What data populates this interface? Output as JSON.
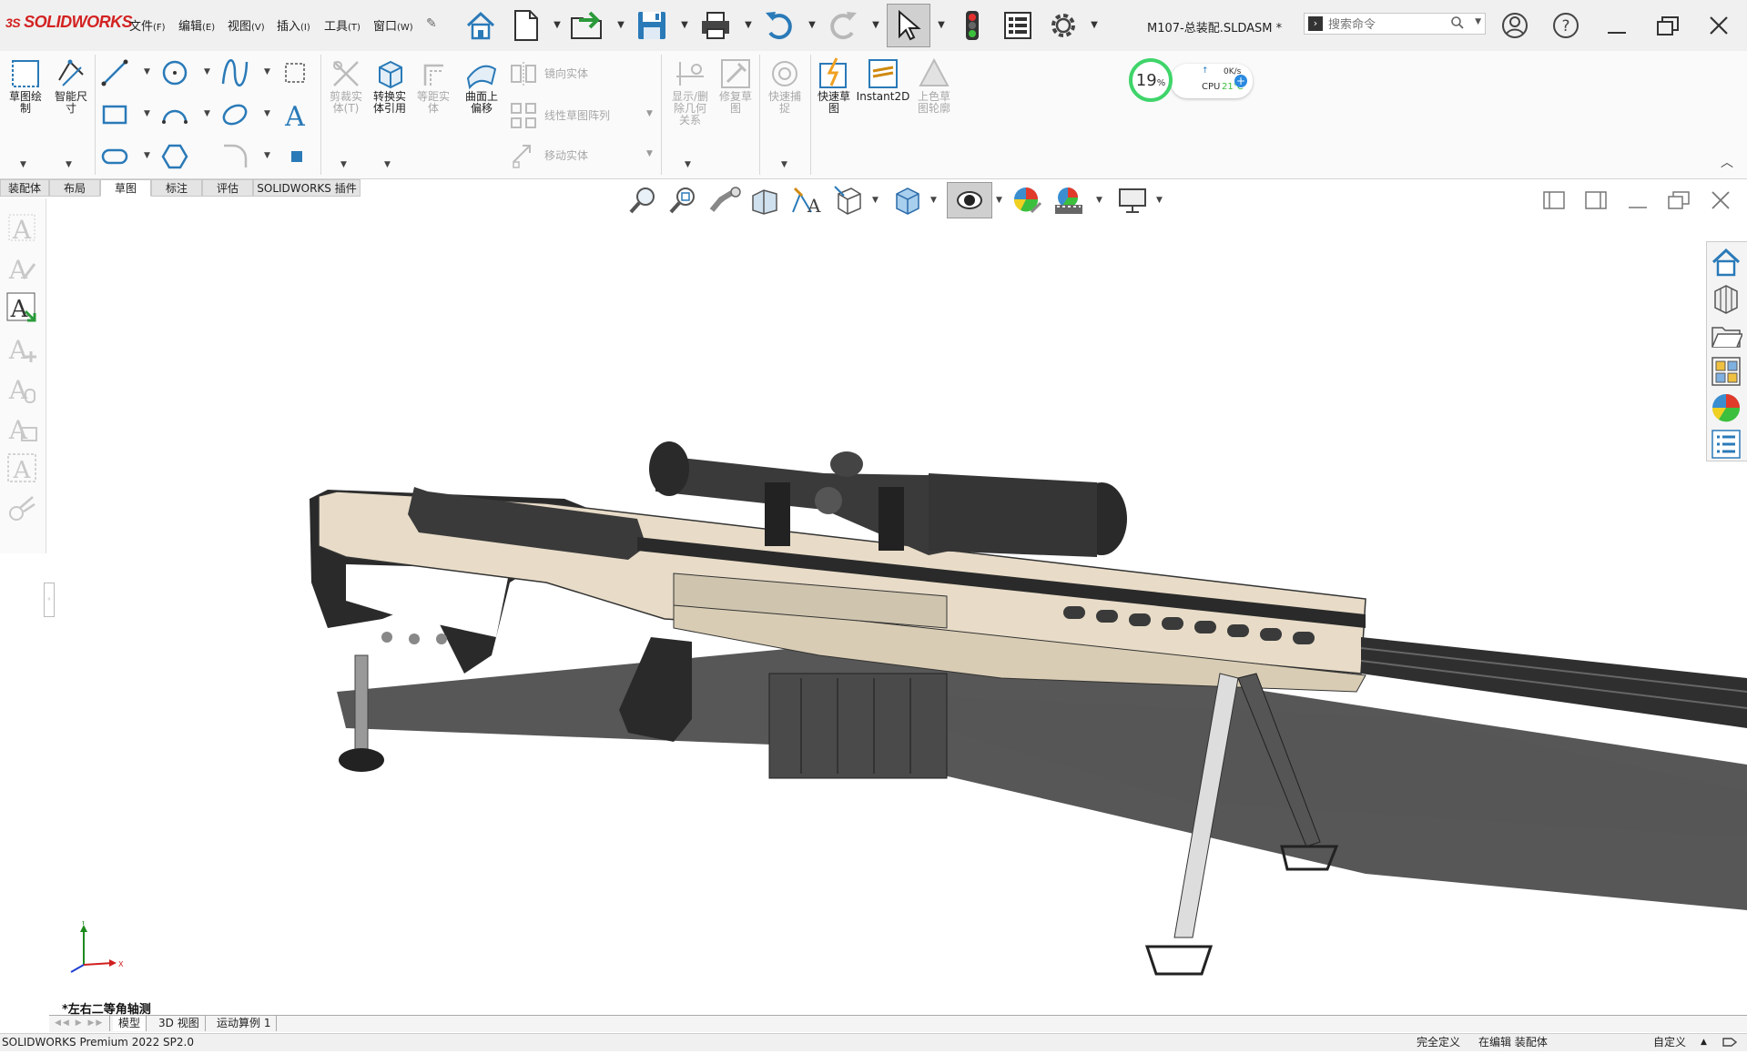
{
  "app": {
    "brand": "SOLIDWORKS",
    "document_title": "M107-总装配.SLDASM *"
  },
  "menu": [
    {
      "label": "文件",
      "key": "(F)"
    },
    {
      "label": "编辑",
      "key": "(E)"
    },
    {
      "label": "视图",
      "key": "(V)"
    },
    {
      "label": "插入",
      "key": "(I)"
    },
    {
      "label": "工具",
      "key": "(T)"
    },
    {
      "label": "窗口",
      "key": "(W)"
    }
  ],
  "search": {
    "placeholder": "搜索命令"
  },
  "ribbon": {
    "sketch": "草图绘\n制",
    "smart_dim": "智能尺\n寸",
    "trim": "剪裁实\n体(T)",
    "convert": "转换实\n体引用",
    "offset": "等距实\n体",
    "surface_offset": "曲面上\n偏移",
    "mirror": "镜向实体",
    "linear_pattern": "线性草图阵列",
    "move": "移动实体",
    "show_relations": "显示/删\n除几何\n关系",
    "repair": "修复草\n图",
    "quick_snap": "快速捕\n捉",
    "rapid_sketch": "快速草\n图",
    "instant2d": "Instant2D",
    "shaded_contours": "上色草\n图轮廓"
  },
  "perf": {
    "percent": "19",
    "percent_sign": "%",
    "net": "0K/s",
    "cpu_label": "CPU",
    "cpu_temp": "21℃"
  },
  "tabs": [
    "装配体",
    "布局",
    "草图",
    "标注",
    "评估",
    "SOLIDWORKS 插件"
  ],
  "view": {
    "orientation_label": "*左右二等角轴测",
    "axis_x": "X",
    "axis_y": "Y"
  },
  "bottom_tabs": [
    "模型",
    "3D 视图",
    "运动算例 1"
  ],
  "status": {
    "product": "SOLIDWORKS Premium 2022 SP2.0",
    "definition": "完全定义",
    "editing": "在编辑 装配体",
    "units": "自定义"
  },
  "colors": {
    "brand_red": "#d32222",
    "accent_blue": "#2a7ab8",
    "perf_green": "#3fd46a",
    "rifle_tan": "#e8dcc8"
  }
}
